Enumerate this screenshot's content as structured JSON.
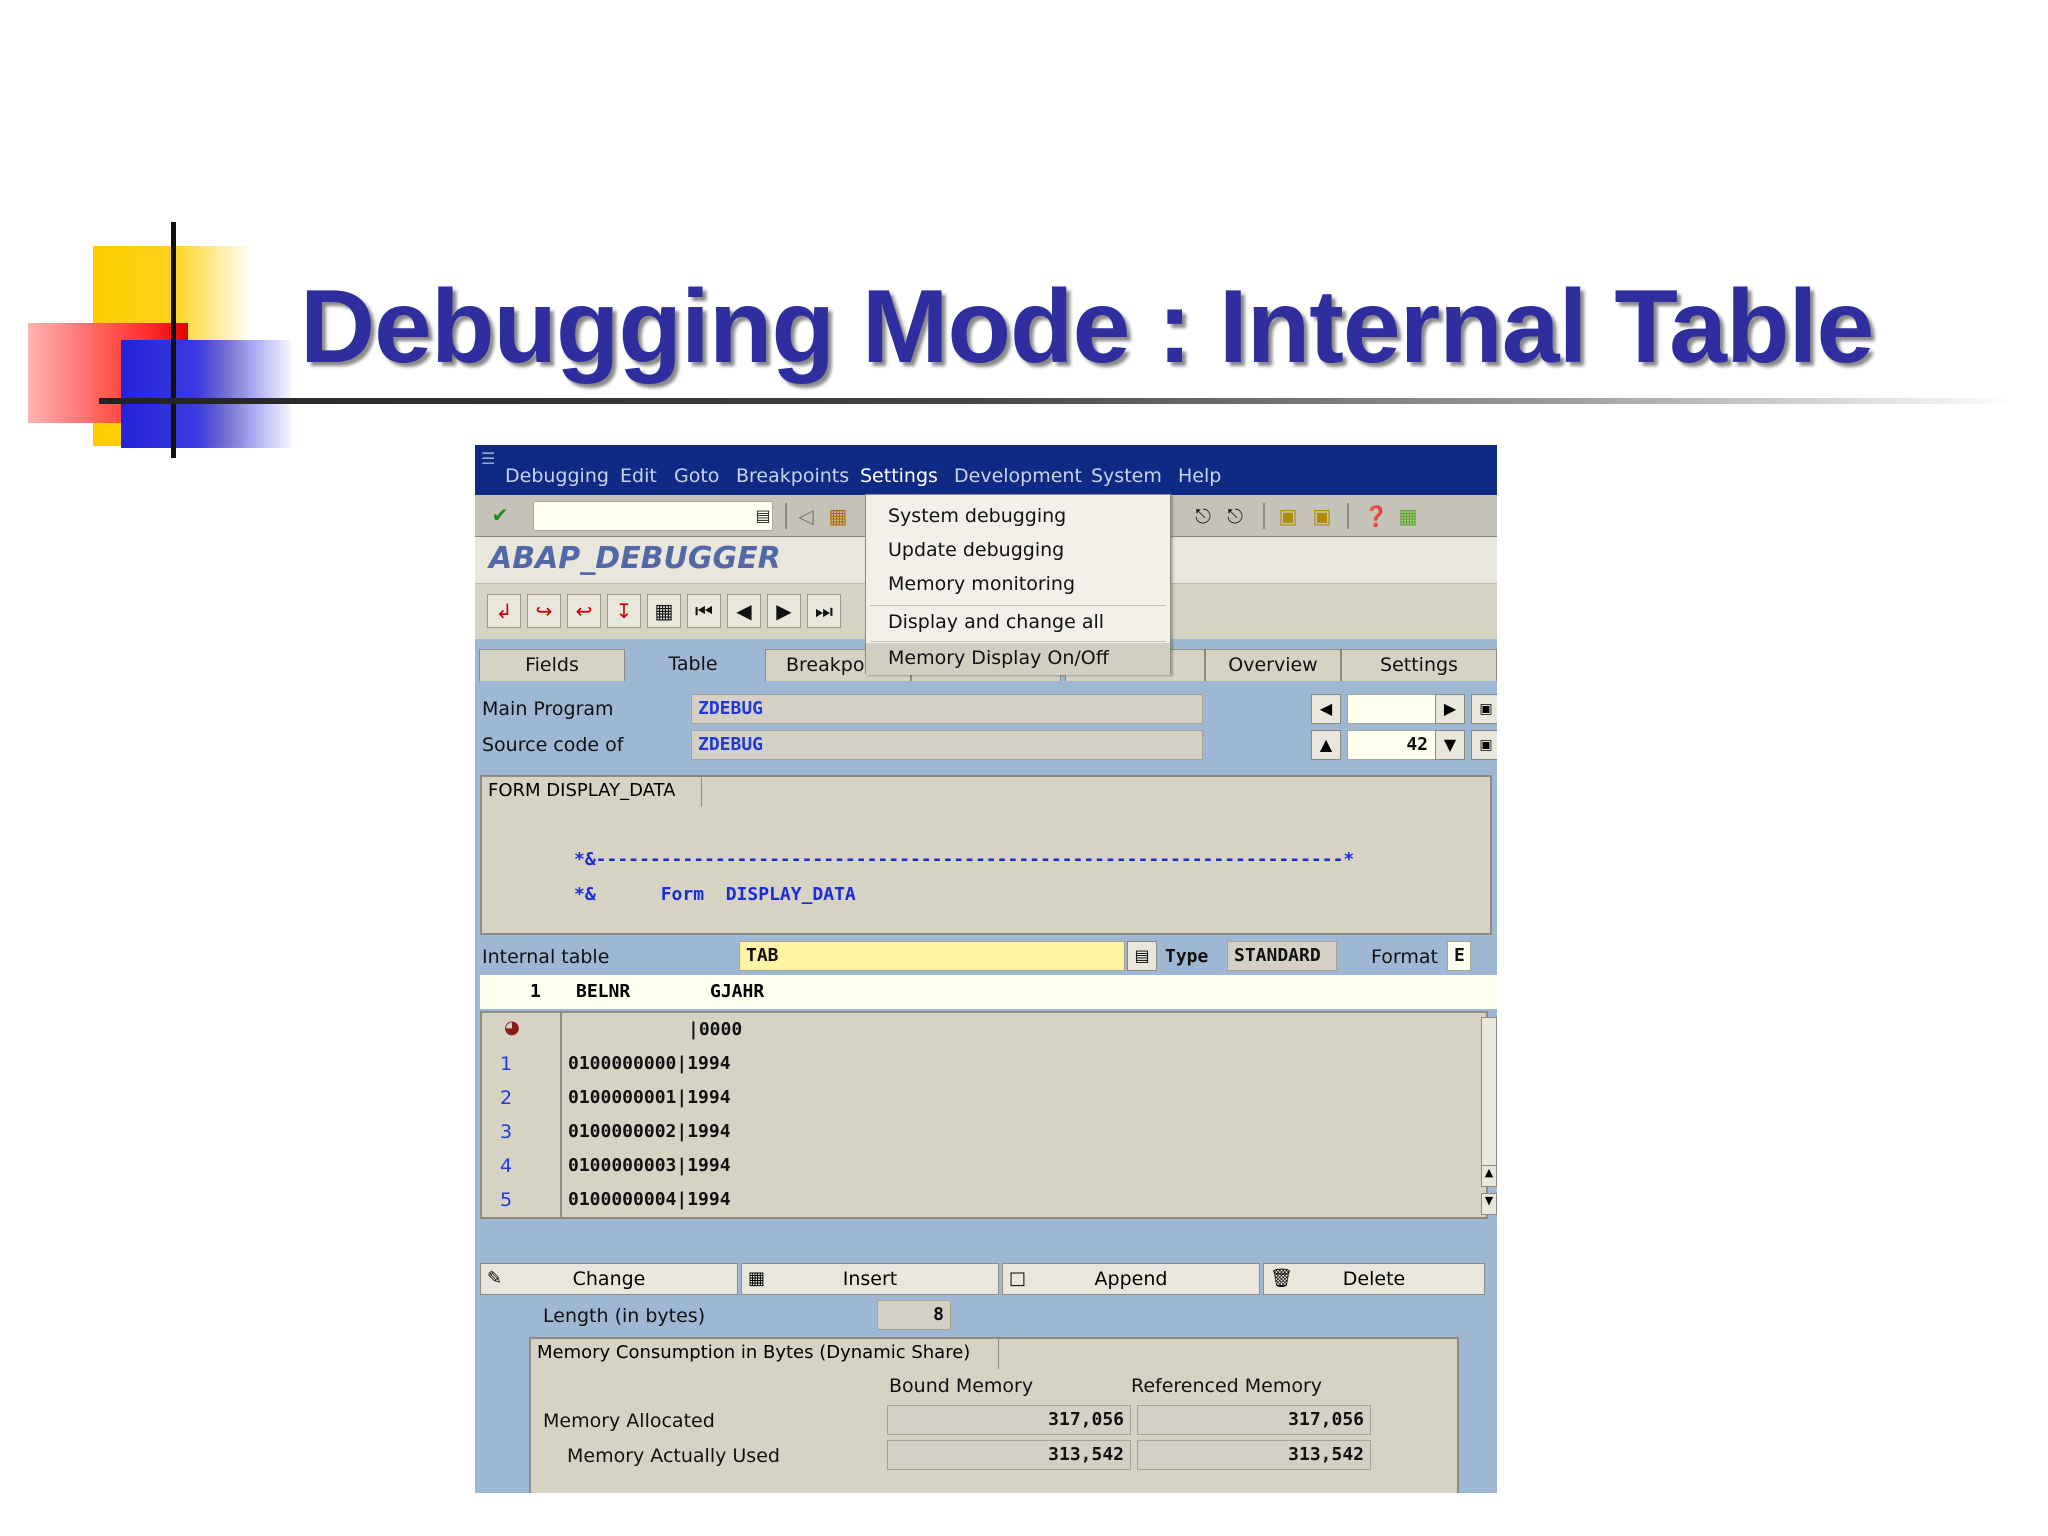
{
  "slide": {
    "title": "Debugging Mode : Internal Table"
  },
  "menubar": {
    "items": [
      "Debugging",
      "Edit",
      "Goto",
      "Breakpoints",
      "Settings",
      "Development",
      "System",
      "Help"
    ]
  },
  "window_title": "ABAP_DEBUGGER",
  "settings_menu": {
    "items": [
      "System debugging",
      "Update debugging",
      "Memory monitoring",
      "Display and change all",
      "Memory Display On/Off"
    ]
  },
  "tabs": {
    "fields": "Fields",
    "table": "Table",
    "breakpoints": "Breakpoi",
    "overview": "Overview",
    "settings": "Settings"
  },
  "program": {
    "main_program_label": "Main Program",
    "main_program_value": "ZDEBUG",
    "source_code_label": "Source code of",
    "source_code_value": "ZDEBUG",
    "line_number": "42"
  },
  "code": {
    "caption": "FORM DISPLAY_DATA",
    "line1": "*&---------------------------------------------------------------------*",
    "line2": "*&      Form  DISPLAY_DATA"
  },
  "internal_table": {
    "label": "Internal table",
    "value": "TAB",
    "type_label": "Type",
    "type_value": "STANDARD",
    "format_label": "Format",
    "format_value": "E",
    "col_index": "1",
    "col_belnr": "BELNR",
    "col_gjahr": "GJAHR",
    "header_row": "|0000",
    "rows": [
      {
        "num": "1",
        "text": "0100000000|1994"
      },
      {
        "num": "2",
        "text": "0100000001|1994"
      },
      {
        "num": "3",
        "text": "0100000002|1994"
      },
      {
        "num": "4",
        "text": "0100000003|1994"
      },
      {
        "num": "5",
        "text": "0100000004|1994"
      }
    ]
  },
  "actions": {
    "change": "Change",
    "insert": "Insert",
    "append": "Append",
    "delete": "Delete"
  },
  "length": {
    "label": "Length (in bytes)",
    "value": "8"
  },
  "memory": {
    "caption": "Memory Consumption in Bytes (Dynamic Share)",
    "bound_header": "Bound Memory",
    "referenced_header": "Referenced Memory",
    "allocated_label": "Memory Allocated",
    "allocated_bound": "317,056",
    "allocated_referenced": "317,056",
    "used_label": "Memory Actually Used",
    "used_bound": "313,542",
    "used_referenced": "313,542"
  },
  "icons": [
    "enter-check-icon",
    "save-icon",
    "back-arrow-icon",
    "help-icon",
    "layout-icon"
  ],
  "colors": {
    "title": "#2e2e9e",
    "menubar": "#0f2a84",
    "window_bg": "#9eb8d3",
    "code_blue": "#1a2ed8"
  }
}
